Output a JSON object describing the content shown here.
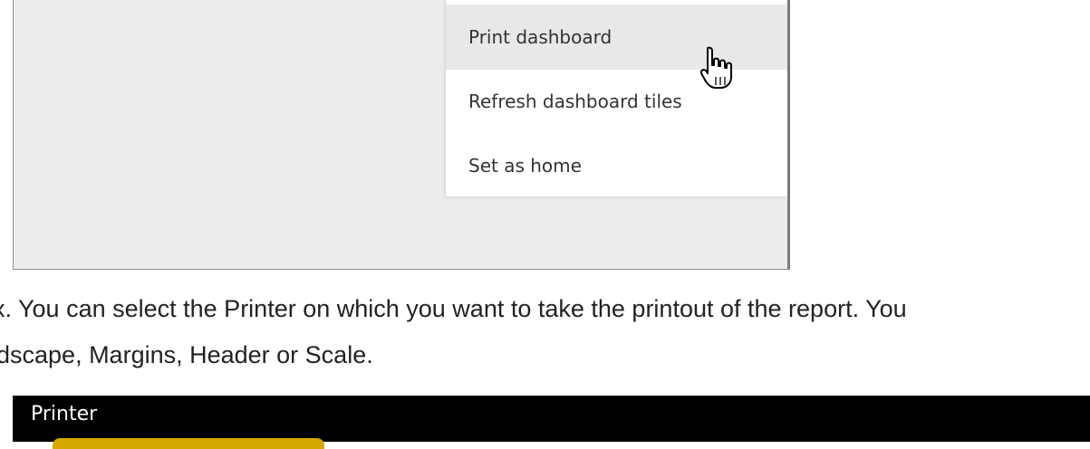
{
  "menu": {
    "items": [
      {
        "label": "Print dashboard"
      },
      {
        "label": "Refresh dashboard tiles"
      },
      {
        "label": "Set as home"
      }
    ]
  },
  "paragraph": {
    "line1": "x. You can select the Printer on which you want to take the printout of the report. You",
    "line2": "dscape, Margins, Header or Scale."
  },
  "printer_dialog": {
    "title": "Printer"
  },
  "colors": {
    "highlight": "#f2c400",
    "menu_hover": "#e8e8e8",
    "dialog_bar": "#000000"
  },
  "icons": {
    "cursor": "hand-pointer-icon"
  }
}
